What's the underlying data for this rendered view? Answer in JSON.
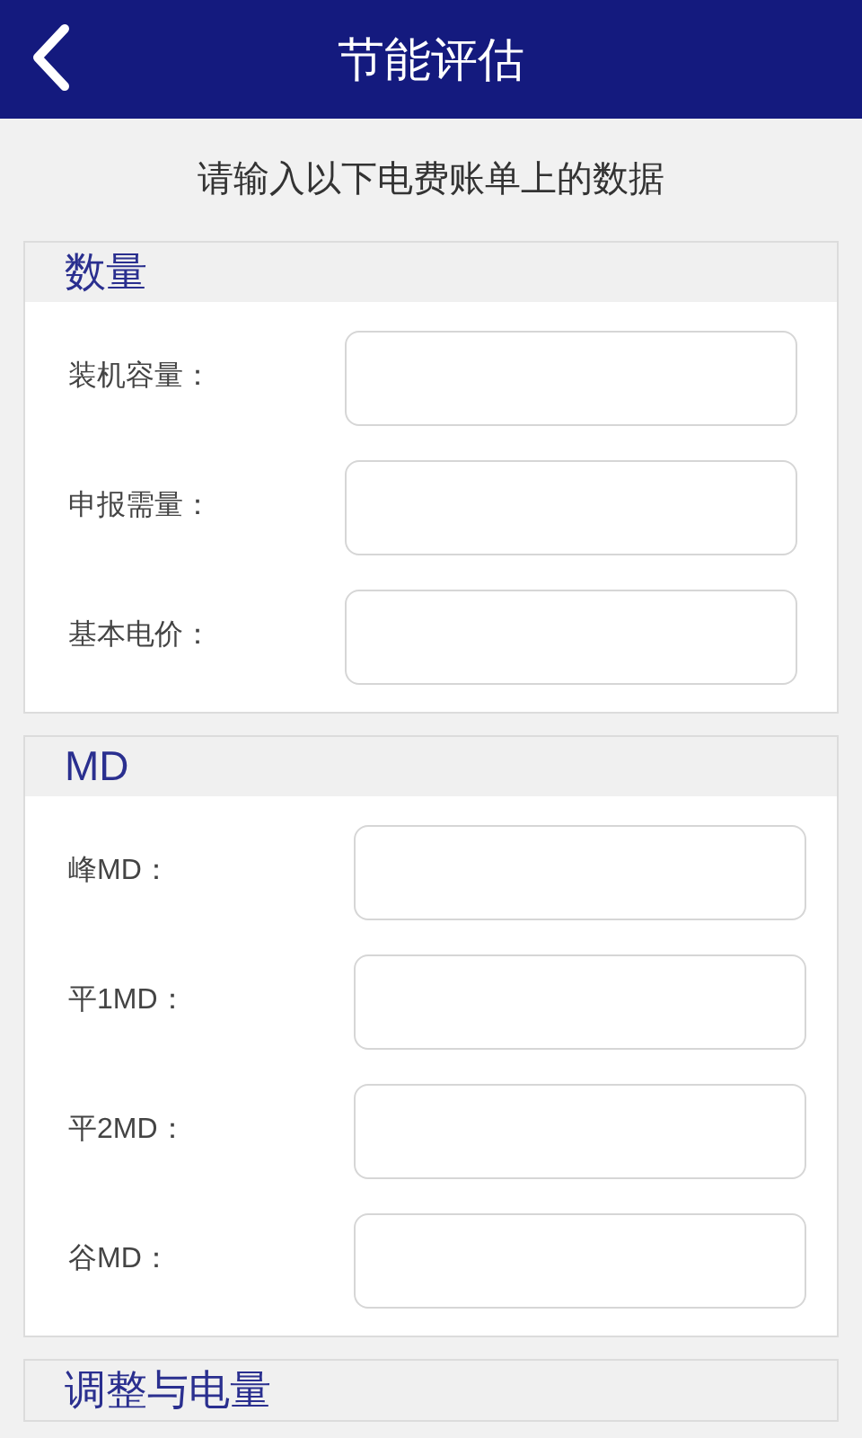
{
  "header": {
    "title": "节能评估"
  },
  "instruction": "请输入以下电费账单上的数据",
  "sections": [
    {
      "title": "数量",
      "fields": [
        {
          "label": "装机容量："
        },
        {
          "label": "申报需量："
        },
        {
          "label": "基本电价："
        }
      ]
    },
    {
      "title": "MD",
      "fields": [
        {
          "label": "峰MD："
        },
        {
          "label": "平1MD："
        },
        {
          "label": "平2MD："
        },
        {
          "label": "谷MD："
        }
      ]
    },
    {
      "title": "调整与电量"
    }
  ]
}
